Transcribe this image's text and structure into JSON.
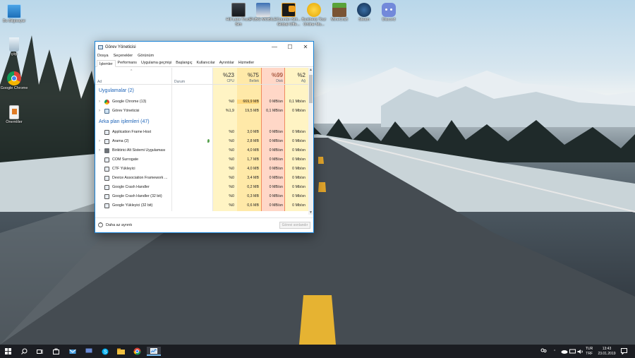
{
  "desktop": {
    "left_icons": [
      {
        "label": "Bu Bilgisayar",
        "icon": "monitor-icon"
      },
      {
        "label": "çöp",
        "icon": "recycle-bin-icon"
      },
      {
        "label": "Google Chrome",
        "icon": "chrome-icon"
      },
      {
        "label": "Önemliler",
        "icon": "folder-icon"
      }
    ],
    "top_icons": [
      {
        "label": "Hill Lara Truck Sim",
        "icon": "game-icon"
      },
      {
        "label": "PUBG MOBILE",
        "icon": "pubg-icon"
      },
      {
        "label": "Counter-Stri... Global Offe...",
        "icon": "csgo-icon"
      },
      {
        "label": "Business Tour Online Mu...",
        "icon": "business-tour-icon"
      },
      {
        "label": "MineCraft",
        "icon": "minecraft-icon"
      },
      {
        "label": "Steam",
        "icon": "steam-icon"
      },
      {
        "label": "Discord",
        "icon": "discord-icon"
      }
    ]
  },
  "taskmanager": {
    "title": "Görev Yöneticisi",
    "menu": [
      "Dosya",
      "Seçenekler",
      "Görünüm"
    ],
    "tabs": [
      "İşlemler",
      "Performans",
      "Uygulama geçmişi",
      "Başlangıç",
      "Kullanıcılar",
      "Ayrıntılar",
      "Hizmetler"
    ],
    "headers": {
      "name": "Ad",
      "status": "Durum",
      "cpu_pct": "%23",
      "cpu": "CPU",
      "mem_pct": "%75",
      "mem": "Bellek",
      "disk_pct": "%99",
      "disk": "Disk",
      "net_pct": "%2",
      "net": "Ağ"
    },
    "groups": {
      "apps": "Uygulamalar (2)",
      "background": "Arka plan işlemleri (47)"
    },
    "apps": [
      {
        "name": "Google Chrome (13)",
        "cpu": "%0",
        "mem": "669,9 MB",
        "disk": "0 MB/sn",
        "net": "0,1 Mb/sn"
      },
      {
        "name": "Görev Yöneticisi",
        "cpu": "%1,9",
        "mem": "19,5 MB",
        "disk": "0,1 MB/sn",
        "net": "0 Mb/sn"
      }
    ],
    "background": [
      {
        "name": "Application Frame Host",
        "cpu": "%0",
        "mem": "3,0 MB",
        "disk": "0 MB/sn",
        "net": "0 Mb/sn"
      },
      {
        "name": "Arama (2)",
        "cpu": "%0",
        "mem": "2,8 MB",
        "disk": "0 MB/sn",
        "net": "0 Mb/sn"
      },
      {
        "name": "Biriktirici Alt Sistemi Uygulaması",
        "cpu": "%0",
        "mem": "4,0 MB",
        "disk": "0 MB/sn",
        "net": "0 Mb/sn"
      },
      {
        "name": "COM Surrogate",
        "cpu": "%0",
        "mem": "1,7 MB",
        "disk": "0 MB/sn",
        "net": "0 Mb/sn"
      },
      {
        "name": "CTF Yükleyici",
        "cpu": "%0",
        "mem": "4,0 MB",
        "disk": "0 MB/sn",
        "net": "0 Mb/sn"
      },
      {
        "name": "Device Association Framework ...",
        "cpu": "%0",
        "mem": "3,4 MB",
        "disk": "0 MB/sn",
        "net": "0 Mb/sn"
      },
      {
        "name": "Google Crash Handler",
        "cpu": "%0",
        "mem": "0,2 MB",
        "disk": "0 MB/sn",
        "net": "0 Mb/sn"
      },
      {
        "name": "Google Crash Handler (32 bit)",
        "cpu": "%0",
        "mem": "0,3 MB",
        "disk": "0 MB/sn",
        "net": "0 Mb/sn"
      },
      {
        "name": "Google Yükleyici (32 bit)",
        "cpu": "%0",
        "mem": "0,6 MB",
        "disk": "0 MB/sn",
        "net": "0 Mb/sn"
      }
    ],
    "footer": {
      "less": "Daha az ayrıntı",
      "end_task": "Görevi sonlandır"
    }
  },
  "taskbar": {
    "lang": "TUR",
    "layout": "TRF",
    "time": "13:43",
    "date": "23.01.2019"
  },
  "colors": {
    "cpu_col": "#fff4c4",
    "mem_col": "#ffe9a8",
    "disk_col": "#ffd7c7",
    "accent": "#1c63b8"
  }
}
